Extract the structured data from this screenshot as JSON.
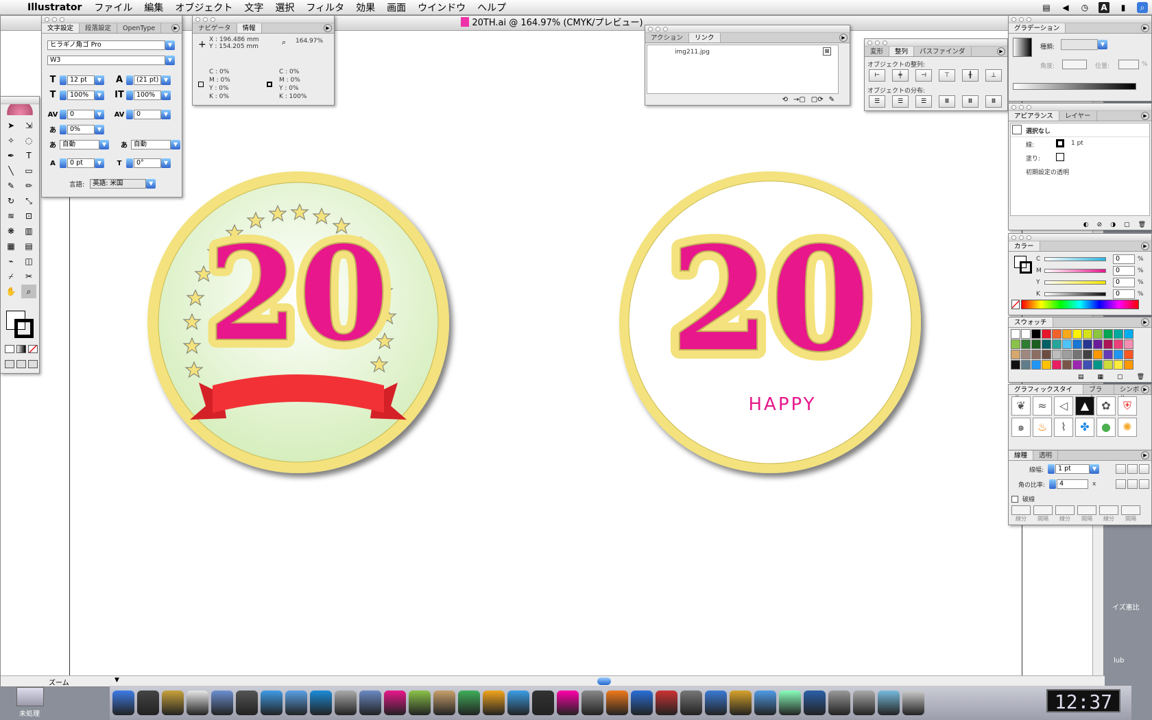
{
  "menubar": {
    "app": "Illustrator",
    "items": [
      "ファイル",
      "編集",
      "オブジェクト",
      "文字",
      "選択",
      "フィルタ",
      "効果",
      "画面",
      "ウインドウ",
      "ヘルプ"
    ]
  },
  "document": {
    "title": "20TH.ai @ 164.97% (CMYK/プレビュー)",
    "zoom_label": "ズーム"
  },
  "character_palette": {
    "tabs": [
      "文字設定",
      "段落設定",
      "OpenType"
    ],
    "font_family": "ヒラギノ角ゴ Pro",
    "font_style": "W3",
    "font_size": "12 pt",
    "leading": "(21 pt)",
    "vscale": "100%",
    "hscale": "100%",
    "kerning": "0",
    "tracking": "0",
    "tsume": "0%",
    "aki_before": "自動",
    "aki_after": "自動",
    "baseline": "0 pt",
    "rotate": "0°",
    "language_label": "言語:",
    "language": "英語: 米国"
  },
  "info_palette": {
    "tabs": [
      "ナビゲータ",
      "情報"
    ],
    "x_label": "X :",
    "x": "196.486 mm",
    "y_label": "Y :",
    "y": "154.205 mm",
    "zoom": "164.97%",
    "left": {
      "C": "0%",
      "M": "0%",
      "Y": "0%",
      "K": "0%"
    },
    "right": {
      "C": "0%",
      "M": "0%",
      "Y": "0%",
      "K": "100%"
    }
  },
  "links_palette": {
    "tabs": [
      "アクション",
      "リンク"
    ],
    "file": "img211.jpg"
  },
  "align_palette": {
    "tabs": [
      "変形",
      "整列",
      "パスファインダ"
    ],
    "align_label": "オブジェクトの整列:",
    "distribute_label": "オブジェクトの分布:"
  },
  "gradient_palette": {
    "tab": "グラデーション",
    "type_label": "種類:",
    "angle_label": "角度:",
    "location_label": "位置:",
    "percent": "%"
  },
  "appearance_palette": {
    "tabs": [
      "アピアランス",
      "レイヤー"
    ],
    "selection": "選択なし",
    "stroke_label": "線:",
    "stroke_value": "1 pt",
    "fill_label": "塗り:",
    "opacity_label": "初期設定の透明"
  },
  "color_palette": {
    "tab": "カラー",
    "channels": [
      {
        "name": "C",
        "value": "0",
        "color": "#2cb5e0"
      },
      {
        "name": "M",
        "value": "0",
        "color": "#e6178c"
      },
      {
        "name": "Y",
        "value": "0",
        "color": "#f5e600"
      },
      {
        "name": "K",
        "value": "0",
        "color": "#111111"
      }
    ],
    "percent": "%"
  },
  "swatches_palette": {
    "tab": "スウォッチ",
    "colors": [
      "#ffffff",
      "#ffffff",
      "#000000",
      "#e6162d",
      "#f0612b",
      "#f7a81b",
      "#fff200",
      "#d4e21a",
      "#8dc63f",
      "#00a651",
      "#00a99d",
      "#00aeef",
      "#8bc34a",
      "#2e7d32",
      "#1b5e20",
      "#006064",
      "#26a69a",
      "#4fc3f7",
      "#1976d2",
      "#283593",
      "#6a1b9a",
      "#ad1457",
      "#ec407a",
      "#f48fb1",
      "#d7a86e",
      "#a1887f",
      "#8d6e63",
      "#6d4c41",
      "#bdbdbd",
      "#9e9e9e",
      "#757575",
      "#424242",
      "#ff9800",
      "#673ab7",
      "#2196f3",
      "#ff5722",
      "#111111",
      "#607d8b",
      "#2196f3",
      "#ffc107",
      "#e91e63",
      "#795548",
      "#9c27b0",
      "#3f51b5",
      "#009688",
      "#cddc39",
      "#ffeb3b",
      "#ff9800"
    ]
  },
  "graphic_styles_palette": {
    "tabs": [
      "グラフィックスタイル",
      "ブラシ",
      "シンボル"
    ],
    "items": [
      "grape-icon",
      "fish-icon",
      "fish2-icon",
      "adobe-icon",
      "flower-icon",
      "shield-icon",
      "swirl-icon",
      "fire-icon",
      "bamboo-icon",
      "butterfly-icon",
      "apple-icon",
      "splash-icon"
    ]
  },
  "stroke_palette": {
    "tabs": [
      "線種",
      "透明"
    ],
    "weight_label": "線幅:",
    "weight": "1 pt",
    "miter_label": "角の比率:",
    "miter": "4",
    "miter_unit": "x",
    "dashed_label": "破線",
    "dash_labels": [
      "線分",
      "間隔",
      "線分",
      "間隔",
      "線分",
      "間隔"
    ]
  },
  "artwork": {
    "number": "20",
    "happy": "HAPPY",
    "badge_yellow": "#f3e27d",
    "badge_pink": "#e8178b",
    "ribbon_red": "#f23136",
    "badge_green": "#e4f5cf"
  },
  "desktop": {
    "unprocessed": "未処理",
    "label1": "イズ憲比",
    "label2": "lub",
    "clock": "12:37"
  }
}
